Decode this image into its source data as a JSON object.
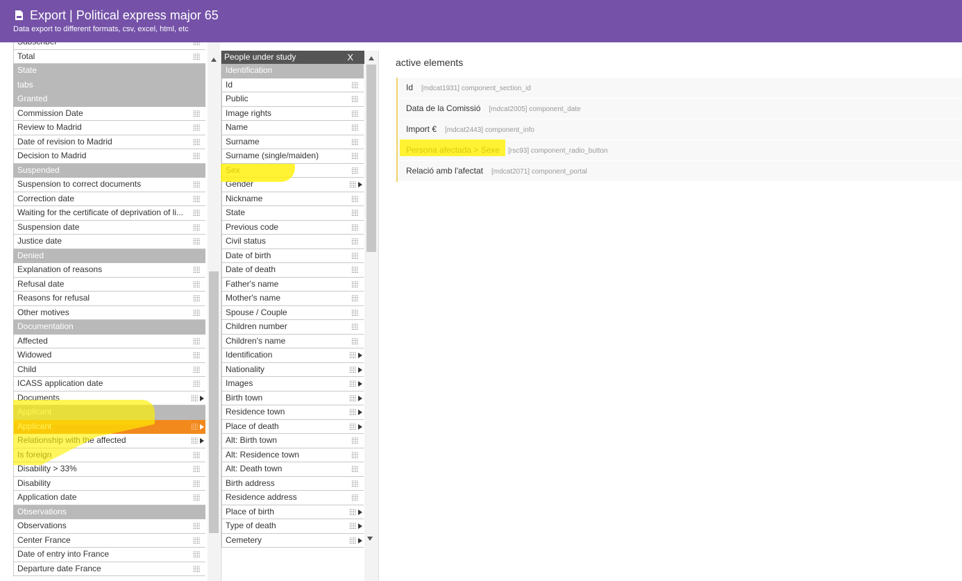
{
  "header": {
    "title": "Export | Political express major 65",
    "subtitle": "Data export to different formats, csv, excel, html, etc"
  },
  "left_list": [
    {
      "type": "item",
      "label": "Subscriber",
      "icon": "grid"
    },
    {
      "type": "item",
      "label": "Total",
      "icon": "grid"
    },
    {
      "type": "section",
      "label": "State"
    },
    {
      "type": "section",
      "label": "tabs"
    },
    {
      "type": "section",
      "label": "Granted"
    },
    {
      "type": "item",
      "label": "Commission Date",
      "icon": "grid"
    },
    {
      "type": "item",
      "label": "Review to Madrid",
      "icon": "grid"
    },
    {
      "type": "item",
      "label": "Date of revision to Madrid",
      "icon": "grid"
    },
    {
      "type": "item",
      "label": "Decision to Madrid",
      "icon": "grid"
    },
    {
      "type": "section",
      "label": "Suspended"
    },
    {
      "type": "item",
      "label": "Suspension to correct documents",
      "icon": "grid"
    },
    {
      "type": "item",
      "label": "Correction date",
      "icon": "grid"
    },
    {
      "type": "item",
      "label": "Waiting for the certificate of deprivation of li...",
      "icon": "grid"
    },
    {
      "type": "item",
      "label": "Suspension date",
      "icon": "grid"
    },
    {
      "type": "item",
      "label": "Justice date",
      "icon": "grid"
    },
    {
      "type": "section",
      "label": "Denied"
    },
    {
      "type": "item",
      "label": "Explanation of reasons",
      "icon": "grid"
    },
    {
      "type": "item",
      "label": "Refusal date",
      "icon": "grid"
    },
    {
      "type": "item",
      "label": "Reasons for refusal",
      "icon": "grid"
    },
    {
      "type": "item",
      "label": "Other motives",
      "icon": "grid"
    },
    {
      "type": "section",
      "label": "Documentation"
    },
    {
      "type": "item",
      "label": "Affected",
      "icon": "grid"
    },
    {
      "type": "item",
      "label": "Widowed",
      "icon": "grid"
    },
    {
      "type": "item",
      "label": "Child",
      "icon": "grid"
    },
    {
      "type": "item",
      "label": "ICASS application date",
      "icon": "grid"
    },
    {
      "type": "item",
      "label": "Documents",
      "icon": "grid-arrow"
    },
    {
      "type": "section",
      "label": "Applicant"
    },
    {
      "type": "item",
      "label": "Applicant",
      "icon": "grid-arrow",
      "selected": true
    },
    {
      "type": "item",
      "label": "Relationship with the affected",
      "icon": "grid-arrow"
    },
    {
      "type": "item",
      "label": "Is foreign",
      "icon": "grid"
    },
    {
      "type": "item",
      "label": "Disability > 33%",
      "icon": "grid"
    },
    {
      "type": "item",
      "label": "Disability",
      "icon": "grid"
    },
    {
      "type": "item",
      "label": "Application date",
      "icon": "grid"
    },
    {
      "type": "section",
      "label": "Observations"
    },
    {
      "type": "item",
      "label": "Observations",
      "icon": "grid"
    },
    {
      "type": "item",
      "label": "Center France",
      "icon": "grid"
    },
    {
      "type": "item",
      "label": "Date of entry into France",
      "icon": "grid"
    },
    {
      "type": "item",
      "label": "Departure date France",
      "icon": "grid"
    }
  ],
  "middle_panel": {
    "title": "People under study",
    "close_label": "X",
    "items": [
      {
        "type": "section",
        "label": "Identification"
      },
      {
        "type": "item",
        "label": "Id",
        "icon": "grid"
      },
      {
        "type": "item",
        "label": "Public",
        "icon": "grid"
      },
      {
        "type": "item",
        "label": "Image rights",
        "icon": "grid"
      },
      {
        "type": "item",
        "label": "Name",
        "icon": "grid"
      },
      {
        "type": "item",
        "label": "Surname",
        "icon": "grid"
      },
      {
        "type": "item",
        "label": "Surname (single/maiden)",
        "icon": "grid"
      },
      {
        "type": "item",
        "label": "Sex",
        "icon": "grid"
      },
      {
        "type": "item",
        "label": "Gender",
        "icon": "grid-arrow"
      },
      {
        "type": "item",
        "label": "Nickname",
        "icon": "grid"
      },
      {
        "type": "item",
        "label": "State",
        "icon": "grid"
      },
      {
        "type": "item",
        "label": "Previous code",
        "icon": "grid"
      },
      {
        "type": "item",
        "label": "Civil status",
        "icon": "grid"
      },
      {
        "type": "item",
        "label": "Date of birth",
        "icon": "grid"
      },
      {
        "type": "item",
        "label": "Date of death",
        "icon": "grid"
      },
      {
        "type": "item",
        "label": "Father's name",
        "icon": "grid"
      },
      {
        "type": "item",
        "label": "Mother's name",
        "icon": "grid"
      },
      {
        "type": "item",
        "label": "Spouse / Couple",
        "icon": "grid"
      },
      {
        "type": "item",
        "label": "Children number",
        "icon": "grid"
      },
      {
        "type": "item",
        "label": "Children's name",
        "icon": "grid"
      },
      {
        "type": "item",
        "label": "Identification",
        "icon": "grid-arrow"
      },
      {
        "type": "item",
        "label": "Nationality",
        "icon": "grid-arrow"
      },
      {
        "type": "item",
        "label": "Images",
        "icon": "grid-arrow"
      },
      {
        "type": "item",
        "label": "Birth town",
        "icon": "grid-arrow"
      },
      {
        "type": "item",
        "label": "Residence town",
        "icon": "grid-arrow"
      },
      {
        "type": "item",
        "label": "Place of death",
        "icon": "grid-arrow"
      },
      {
        "type": "item",
        "label": "Alt: Birth town",
        "icon": "grid"
      },
      {
        "type": "item",
        "label": "Alt: Residence town",
        "icon": "grid"
      },
      {
        "type": "item",
        "label": "Alt: Death town",
        "icon": "grid"
      },
      {
        "type": "item",
        "label": "Birth address",
        "icon": "grid"
      },
      {
        "type": "item",
        "label": "Residence address",
        "icon": "grid"
      },
      {
        "type": "item",
        "label": "Place of birth",
        "icon": "grid-arrow"
      },
      {
        "type": "item",
        "label": "Type of death",
        "icon": "grid-arrow"
      },
      {
        "type": "item",
        "label": "Cemetery",
        "icon": "grid-arrow"
      }
    ]
  },
  "active_elements": {
    "title": "active elements",
    "items": [
      {
        "label": "Id",
        "tipo": "[mdcat1931] component_section_id"
      },
      {
        "label": "Data de la Comissió",
        "tipo": "[mdcat2005] component_date"
      },
      {
        "label": "Import €",
        "tipo": "[mdcat2443] component_info"
      },
      {
        "label": "Persona afectada > Sexe",
        "tipo": "[rsc93] component_radio_button"
      },
      {
        "label": "Relació amb l'afectat",
        "tipo": "[mdcat2071] component_portal"
      }
    ]
  },
  "colors": {
    "header_bg": "#7552a8",
    "section_bg": "#b9b9b9",
    "selected_bg": "#f2891d",
    "highlight": "#fff000"
  }
}
